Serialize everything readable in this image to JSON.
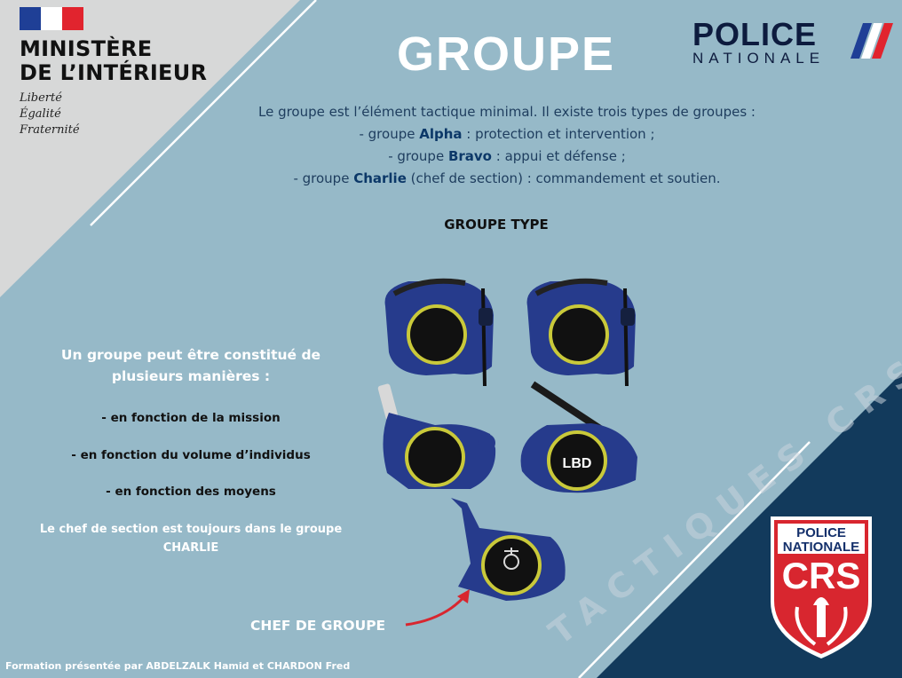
{
  "ministry": {
    "name_line1": "MINISTÈRE",
    "name_line2": "DE L’INTÉRIEUR",
    "motto": [
      "Liberté",
      "Égalité",
      "Fraternité"
    ]
  },
  "title": "GROUPE",
  "logo": {
    "police": "POLICE",
    "nationale": "NATIONALE"
  },
  "intro": {
    "line1": "Le groupe est l’élément tactique minimal. Il existe trois types de groupes :",
    "items": [
      {
        "prefix": "- groupe ",
        "name": "Alpha",
        "desc": " : protection et intervention ;"
      },
      {
        "prefix": "- groupe ",
        "name": "Bravo",
        "desc": " : appui et défense ;"
      },
      {
        "prefix": "- groupe ",
        "name": "Charlie",
        "desc": " (chef de section) : commandement et soutien."
      }
    ]
  },
  "subheading": "GROUPE TYPE",
  "left": {
    "title": "Un groupe peut être constitué de plusieurs manières :",
    "items": [
      "- en fonction de la mission",
      "- en fonction du volume d’individus",
      "- en fonction des moyens"
    ],
    "note": "Le chef de section est toujours dans le groupe CHARLIE"
  },
  "figure": {
    "lbd_label": "LBD"
  },
  "chef_label": "CHEF DE GROUPE",
  "watermark": "TACTIQUES CRS",
  "crs_badge": {
    "line1": "POLICE",
    "line2": "NATIONALE",
    "line3": "CRS"
  },
  "footer": "Formation présentée par ABDELZALK Hamid et CHARDON Fred",
  "colors": {
    "background": "#96b9c8",
    "navy_corner": "#123a5c",
    "light_corner": "#d7d8d8",
    "accent_red": "#d8262f",
    "text_navy": "#1e3d5e"
  }
}
